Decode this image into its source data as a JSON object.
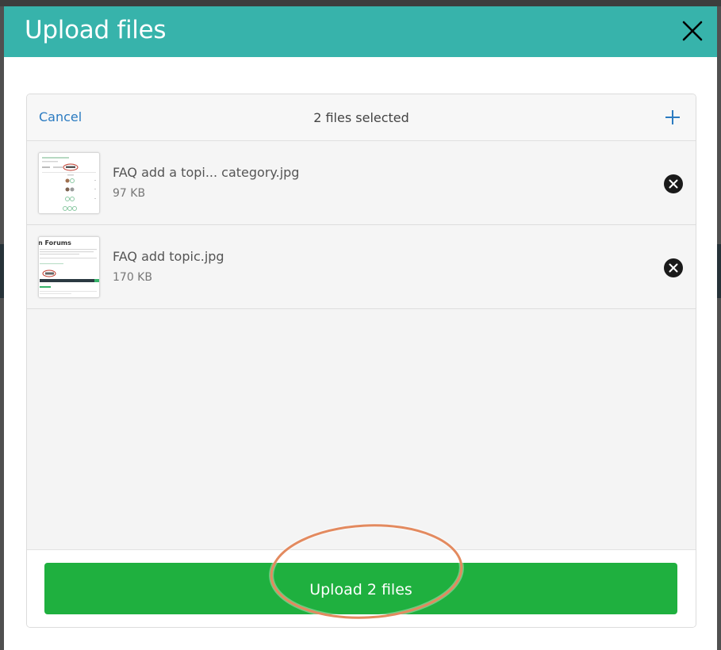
{
  "modal": {
    "title": "Upload files",
    "close_icon": "close-icon"
  },
  "toolbar": {
    "cancel_label": "Cancel",
    "selection_status": "2 files selected",
    "add_icon": "plus-icon"
  },
  "files": [
    {
      "name": "FAQ add a topi... category.jpg",
      "size": "97 KB",
      "thumbnail_icon": "image-thumbnail",
      "remove_icon": "remove-circle-icon"
    },
    {
      "name": "FAQ add topic.jpg",
      "size": "170 KB",
      "thumbnail_icon": "image-thumbnail",
      "thumbnail_text": "n Forums",
      "remove_icon": "remove-circle-icon"
    }
  ],
  "footer": {
    "upload_label": "Upload 2 files"
  },
  "colors": {
    "header": "#37b3ab",
    "upload_button": "#1fb03f",
    "link": "#2b7bc1",
    "annotation": "#e38a5f"
  }
}
